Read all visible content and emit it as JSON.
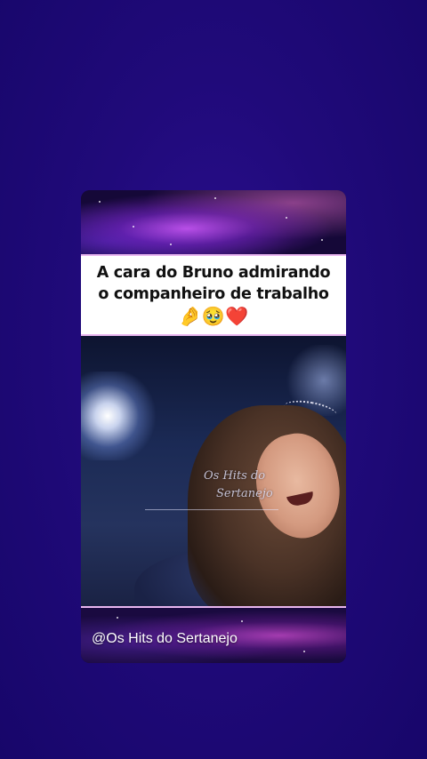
{
  "caption": {
    "line1": "A cara do Bruno admirando",
    "line2": "o companheiro de trabalho",
    "emojis": "🤌🥹❤️"
  },
  "watermark": {
    "line1": "Os Hits do",
    "line2": "Sertanejo"
  },
  "footer": {
    "handle": "@Os Hits do Sertanejo"
  },
  "colors": {
    "background": "#200a7a",
    "caption_bg": "#ffffff",
    "caption_border": "#e9b6f0",
    "text_dark": "#111111",
    "text_light": "#ffffff"
  }
}
